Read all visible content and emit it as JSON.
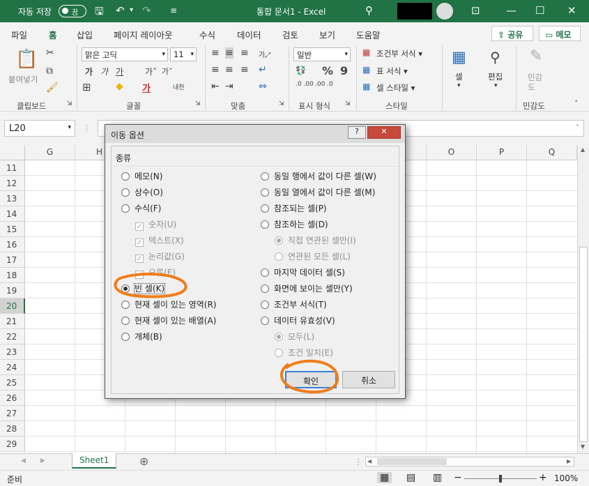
{
  "titlebar": {
    "autosave_label": "자동 저장",
    "toggle_label": "끔",
    "doc_title": "통합 문서1  -  Excel"
  },
  "menu": {
    "items": [
      "파일",
      "홈",
      "삽입",
      "페이지 레이아웃",
      "수식",
      "데이터",
      "검토",
      "보기",
      "도움말"
    ],
    "share": "공유",
    "memo": "메모"
  },
  "ribbon": {
    "paste": "붙여넣기",
    "font_name": "맑은 고딕",
    "font_size": "11",
    "number_format": "일반",
    "cond_format": "조건부 서식",
    "table_format": "표 서식",
    "cell_style": "셀 스타일",
    "cells": "셀",
    "edit": "편집",
    "sensitivity": "민감\n도",
    "groups": [
      "클립보드",
      "글꼴",
      "맞춤",
      "표시 형식",
      "스타일",
      "민감도"
    ]
  },
  "namebox": "L20",
  "columns": [
    "G",
    "H",
    "O",
    "P",
    "Q"
  ],
  "rows": [
    "11",
    "12",
    "13",
    "14",
    "15",
    "16",
    "17",
    "18",
    "19",
    "20",
    "21",
    "22",
    "23",
    "24",
    "25",
    "26",
    "27",
    "28",
    "29"
  ],
  "selected_row": "20",
  "sheet": {
    "tab": "Sheet1"
  },
  "status": {
    "ready": "준비",
    "zoom": "100%"
  },
  "dialog": {
    "title": "이동 옵션",
    "help": "?",
    "group": "종류",
    "left": [
      {
        "label": "메모(N)",
        "type": "radio",
        "checked": false,
        "disabled": false
      },
      {
        "label": "상수(O)",
        "type": "radio",
        "checked": false,
        "disabled": false
      },
      {
        "label": "수식(F)",
        "type": "radio",
        "checked": false,
        "disabled": false
      },
      {
        "label": "숫자(U)",
        "type": "check",
        "checked": true,
        "disabled": true
      },
      {
        "label": "텍스트(X)",
        "type": "check",
        "checked": true,
        "disabled": true
      },
      {
        "label": "논리값(G)",
        "type": "check",
        "checked": true,
        "disabled": true
      },
      {
        "label": "오류(E)",
        "type": "check",
        "checked": true,
        "disabled": true
      },
      {
        "label": "빈 셀(K)",
        "type": "radio",
        "checked": true,
        "disabled": false
      },
      {
        "label": "현재 셀이 있는 영역(R)",
        "type": "radio",
        "checked": false,
        "disabled": false
      },
      {
        "label": "현재 셀이 있는 배열(A)",
        "type": "radio",
        "checked": false,
        "disabled": false
      },
      {
        "label": "개체(B)",
        "type": "radio",
        "checked": false,
        "disabled": false
      }
    ],
    "right": [
      {
        "label": "동일 행에서 값이 다른 셀(W)",
        "type": "radio",
        "checked": false,
        "disabled": false
      },
      {
        "label": "동일 열에서 값이 다른 셀(M)",
        "type": "radio",
        "checked": false,
        "disabled": false
      },
      {
        "label": "참조되는 셀(P)",
        "type": "radio",
        "checked": false,
        "disabled": false
      },
      {
        "label": "참조하는 셀(D)",
        "type": "radio",
        "checked": false,
        "disabled": false
      },
      {
        "label": "직접 연관된 셀만(I)",
        "type": "radio",
        "checked": true,
        "disabled": true
      },
      {
        "label": "연관된 모든 셀(L)",
        "type": "radio",
        "checked": false,
        "disabled": true
      },
      {
        "label": "마지막 데이터 셀(S)",
        "type": "radio",
        "checked": false,
        "disabled": false
      },
      {
        "label": "화면에 보이는 셀만(Y)",
        "type": "radio",
        "checked": false,
        "disabled": false
      },
      {
        "label": "조건부 서식(T)",
        "type": "radio",
        "checked": false,
        "disabled": false
      },
      {
        "label": "데이터 유효성(V)",
        "type": "radio",
        "checked": false,
        "disabled": false
      },
      {
        "label": "모두(L)",
        "type": "radio",
        "checked": true,
        "disabled": true
      },
      {
        "label": "조건 일치(E)",
        "type": "radio",
        "checked": false,
        "disabled": true
      }
    ],
    "ok": "확인",
    "cancel": "취소"
  },
  "colors": {
    "excel_green": "#217346",
    "annotation": "#f07d1a"
  }
}
